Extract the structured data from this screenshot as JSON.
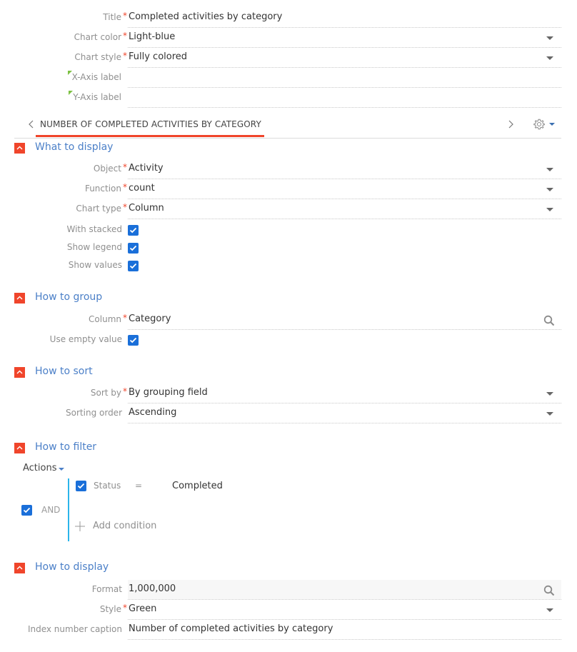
{
  "general": {
    "fields": [
      {
        "label": "Title",
        "required": "*",
        "value": "Completed activities by category",
        "control": "text"
      },
      {
        "label": "Chart color",
        "required": "*",
        "value": "Light-blue",
        "control": "dropdown"
      },
      {
        "label": "Chart style",
        "required": "*",
        "value": "Fully colored",
        "control": "dropdown"
      },
      {
        "label": "X-Axis label",
        "required": "",
        "value": "",
        "control": "text",
        "localizable": true
      },
      {
        "label": "Y-Axis label",
        "required": "",
        "value": "",
        "control": "text",
        "localizable": true
      }
    ]
  },
  "tabbar": {
    "tab_label": "NUMBER OF COMPLETED ACTIVITIES BY CATEGORY",
    "prev_icon": "chevron-left-icon",
    "next_icon": "chevron-right-icon",
    "settings_icon": "gear-icon",
    "accent_color": "#f0452b"
  },
  "sections": {
    "what_to_display": {
      "title": "What to display",
      "fields": [
        {
          "label": "Object",
          "required": "*",
          "value": "Activity"
        },
        {
          "label": "Function",
          "required": "*",
          "value": "count"
        },
        {
          "label": "Chart type",
          "required": "*",
          "value": "Column"
        }
      ],
      "checkboxes": [
        {
          "label": "With stacked",
          "checked": true
        },
        {
          "label": "Show legend",
          "checked": true
        },
        {
          "label": "Show values",
          "checked": true
        }
      ]
    },
    "how_to_group": {
      "title": "How to group",
      "column": {
        "label": "Column",
        "required": "*",
        "value": "Category"
      },
      "use_empty": {
        "label": "Use empty value",
        "checked": true
      }
    },
    "how_to_sort": {
      "title": "How to sort",
      "sort_by": {
        "label": "Sort by",
        "required": "*",
        "value": "By grouping field"
      },
      "order": {
        "label": "Sorting order",
        "value": "Ascending"
      }
    },
    "how_to_filter": {
      "title": "How to filter",
      "actions_label": "Actions",
      "group_operator": "AND",
      "group_checked": true,
      "conditions": [
        {
          "field": "Status",
          "operator": "=",
          "value": "Completed",
          "checked": true
        }
      ],
      "add_condition_label": "Add condition"
    },
    "how_to_display": {
      "title": "How to display",
      "format": {
        "label": "Format",
        "value": "1,000,000"
      },
      "style": {
        "label": "Style",
        "required": "*",
        "value": "Green"
      },
      "caption": {
        "label": "Index number caption",
        "value": "Number of completed activities by category"
      }
    }
  },
  "colors": {
    "required_asterisk": "#f0452b",
    "section_title": "#4c80c8",
    "checkbox": "#1a6fd9",
    "filter_bar": "#2bb5ea",
    "localizable_marker": "#7cc142"
  }
}
